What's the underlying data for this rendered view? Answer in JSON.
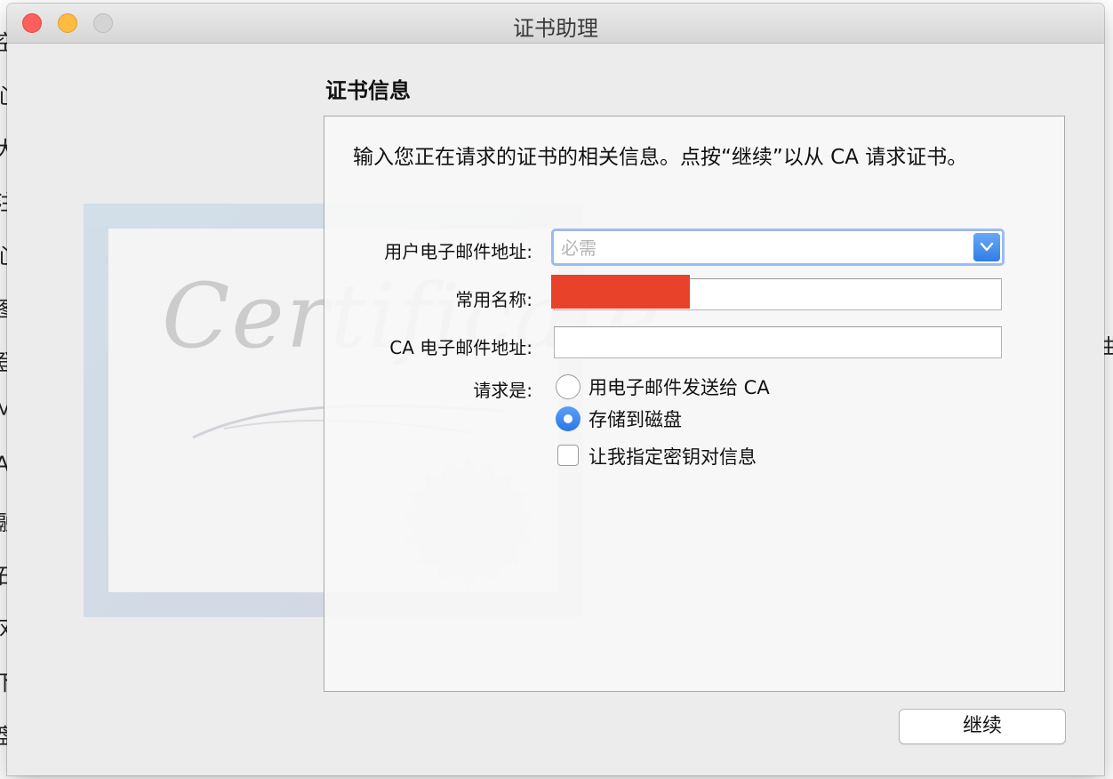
{
  "window": {
    "title": "证书助理"
  },
  "background_app": {
    "left_edge_chars": [
      "空",
      "心",
      "大",
      "注",
      "心",
      "图",
      "登",
      "M",
      "A",
      "融",
      "石",
      "风",
      "下",
      "盘"
    ],
    "right_edge_chars": [
      "曲"
    ]
  },
  "section": {
    "title": "证书信息"
  },
  "panel": {
    "intro": "输入您正在请求的证书的相关信息。点按“继续”以从 CA 请求证书。",
    "artwork_text": "Certificate"
  },
  "form": {
    "email_label": "用户电子邮件地址:",
    "email_placeholder": "必需",
    "email_value": "",
    "common_name_label": "常用名称:",
    "common_name_value": "",
    "ca_email_label": "CA 电子邮件地址:",
    "ca_email_value": "",
    "request_label": "请求是:",
    "options": [
      {
        "label": "用电子邮件发送给 CA",
        "checked": false
      },
      {
        "label": "存储到磁盘",
        "checked": true
      }
    ],
    "key_pair_label": "让我指定密钥对信息",
    "key_pair_checked": false
  },
  "buttons": {
    "continue": "继续"
  },
  "colors": {
    "accent": "#2f7de8",
    "redaction": "#e8422a",
    "close": "#fc605c",
    "minimize": "#fdbc40",
    "zoom_disabled": "#d4d4d4"
  }
}
